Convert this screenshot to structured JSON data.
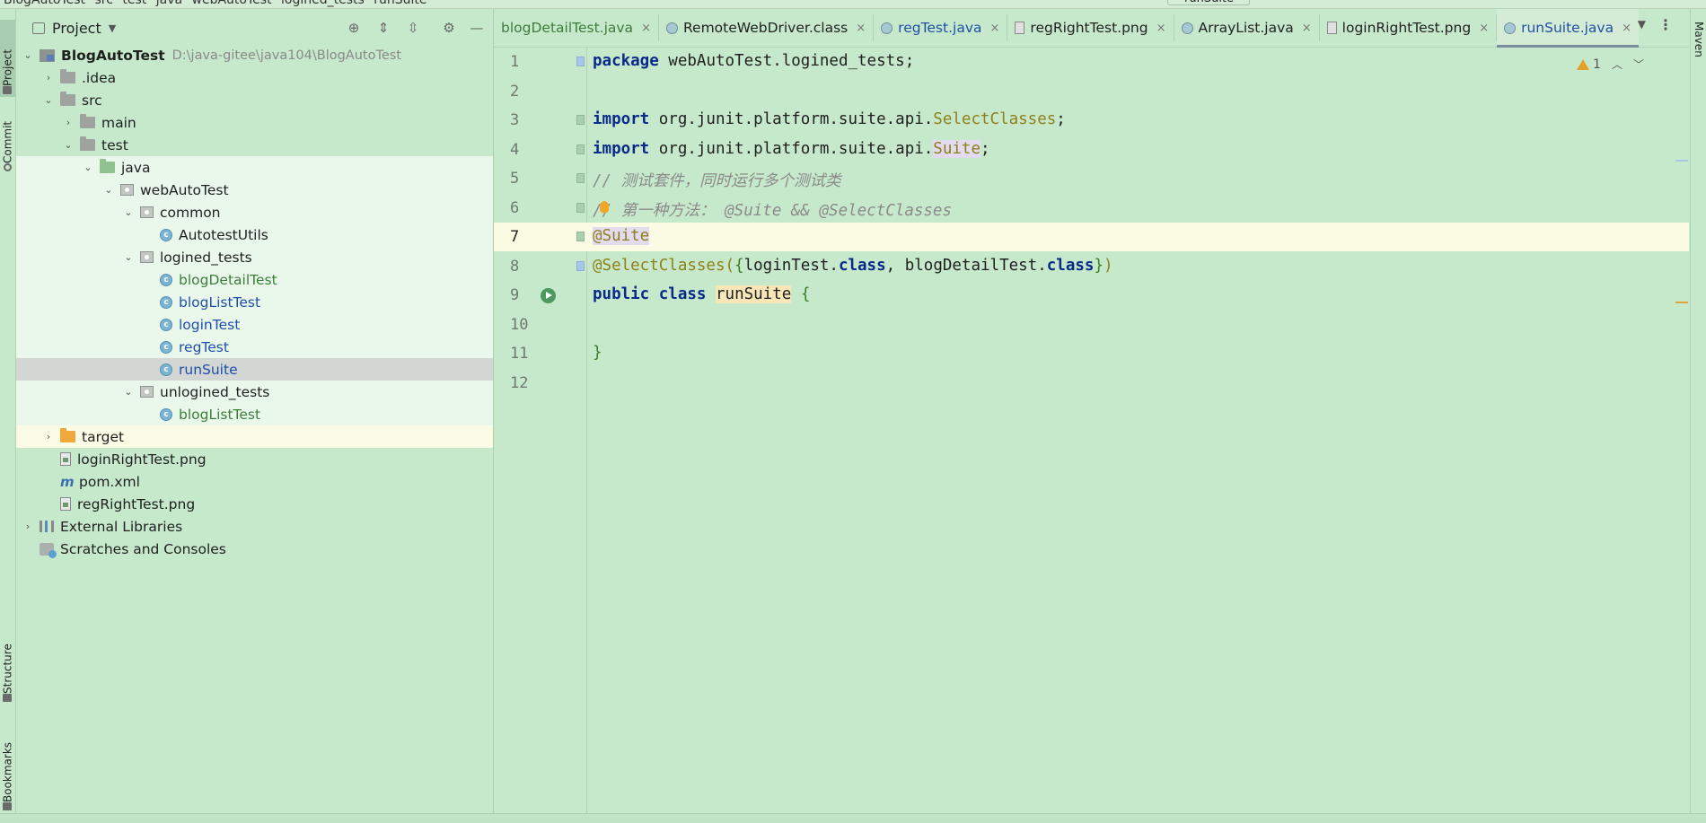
{
  "navbar": {
    "breadcrumbs": [
      "BlogAutoTest",
      "src",
      "test",
      "java",
      "webAutoTest",
      "logined_tests",
      "runSuite"
    ],
    "run_config": "runSuite"
  },
  "tool_windows": {
    "project": "Project",
    "commit": "Commit",
    "structure": "Structure",
    "bookmarks": "Bookmarks",
    "maven": "Maven"
  },
  "project_panel": {
    "title": "Project",
    "tree": [
      {
        "label": "BlogAutoTest",
        "path": "D:\\java-gitee\\java104\\BlogAutoTest"
      },
      {
        "label": ".idea"
      },
      {
        "label": "src"
      },
      {
        "label": "main"
      },
      {
        "label": "test"
      },
      {
        "label": "java"
      },
      {
        "label": "webAutoTest"
      },
      {
        "label": "common"
      },
      {
        "label": "AutotestUtils"
      },
      {
        "label": "logined_tests"
      },
      {
        "label": "blogDetailTest"
      },
      {
        "label": "blogListTest"
      },
      {
        "label": "loginTest"
      },
      {
        "label": "regTest"
      },
      {
        "label": "runSuite"
      },
      {
        "label": "unlogined_tests"
      },
      {
        "label": "blogListTest"
      },
      {
        "label": "target"
      },
      {
        "label": "loginRightTest.png"
      },
      {
        "label": "pom.xml"
      },
      {
        "label": "regRightTest.png"
      },
      {
        "label": "External Libraries"
      },
      {
        "label": "Scratches and Consoles"
      }
    ]
  },
  "editor": {
    "tabs": [
      {
        "label": "blogDetailTest.java"
      },
      {
        "label": "RemoteWebDriver.class"
      },
      {
        "label": "regTest.java"
      },
      {
        "label": "regRightTest.png"
      },
      {
        "label": "ArrayList.java"
      },
      {
        "label": "loginRightTest.png"
      },
      {
        "label": "runSuite.java"
      }
    ],
    "close_glyph": "×",
    "warning_count": "1",
    "line_numbers": [
      "1",
      "2",
      "3",
      "4",
      "5",
      "6",
      "7",
      "8",
      "9",
      "10",
      "11",
      "12"
    ],
    "code": {
      "l1_kw": "package",
      "l1_rest": " webAutoTest.logined_tests;",
      "l3_kw": "import",
      "l3_mid": " org.junit.platform.suite.api.",
      "l3_cls": "SelectClasses",
      "l3_end": ";",
      "l4_kw": "import",
      "l4_mid": " org.junit.platform.suite.api.",
      "l4_cls": "Suite",
      "l4_end": ";",
      "l5_comment": "// 测试套件，同时运行多个测试类",
      "l6_comment": "// 第一种方法： @Suite && @SelectClasses",
      "l7_ann": "@Suite",
      "l8_ann": "@SelectClasses(",
      "l8_brace_open": "{",
      "l8_a": "loginTest.",
      "l8_kw1": "class",
      "l8_b": ", blogDetailTest.",
      "l8_kw2": "class",
      "l8_brace_close": "}",
      "l8_paren": ")",
      "l9_kw1": "public",
      "l9_kw2": "class",
      "l9_name": "runSuite",
      "l9_brace": "{",
      "l11_brace": "}"
    }
  }
}
